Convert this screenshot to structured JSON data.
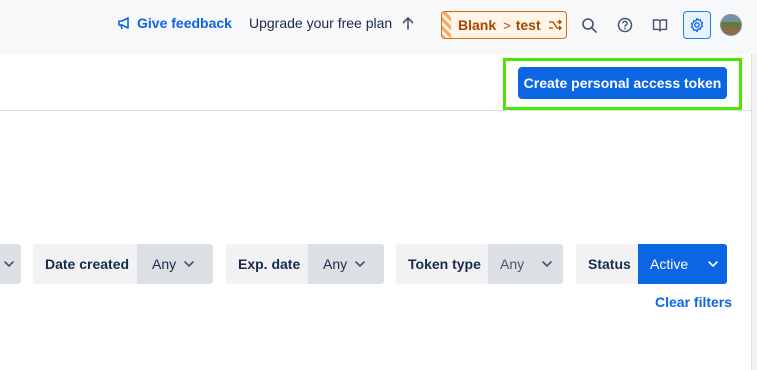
{
  "nav": {
    "feedback_label": "Give feedback",
    "upgrade_label": "Upgrade your free plan",
    "crumb": {
      "space": "Blank",
      "page": "test"
    }
  },
  "header": {
    "create_button_label": "Create personal access token"
  },
  "filters": [
    {
      "label": "Date created",
      "value": "Any"
    },
    {
      "label": "Exp. date",
      "value": "Any"
    },
    {
      "label": "Token type",
      "value": "Any"
    },
    {
      "label": "Status",
      "value": "Active"
    }
  ],
  "clear_filters_label": "Clear filters",
  "colors": {
    "accent": "#0c66e4",
    "highlight_border": "#4ce600",
    "crumb_border": "#e56910"
  }
}
